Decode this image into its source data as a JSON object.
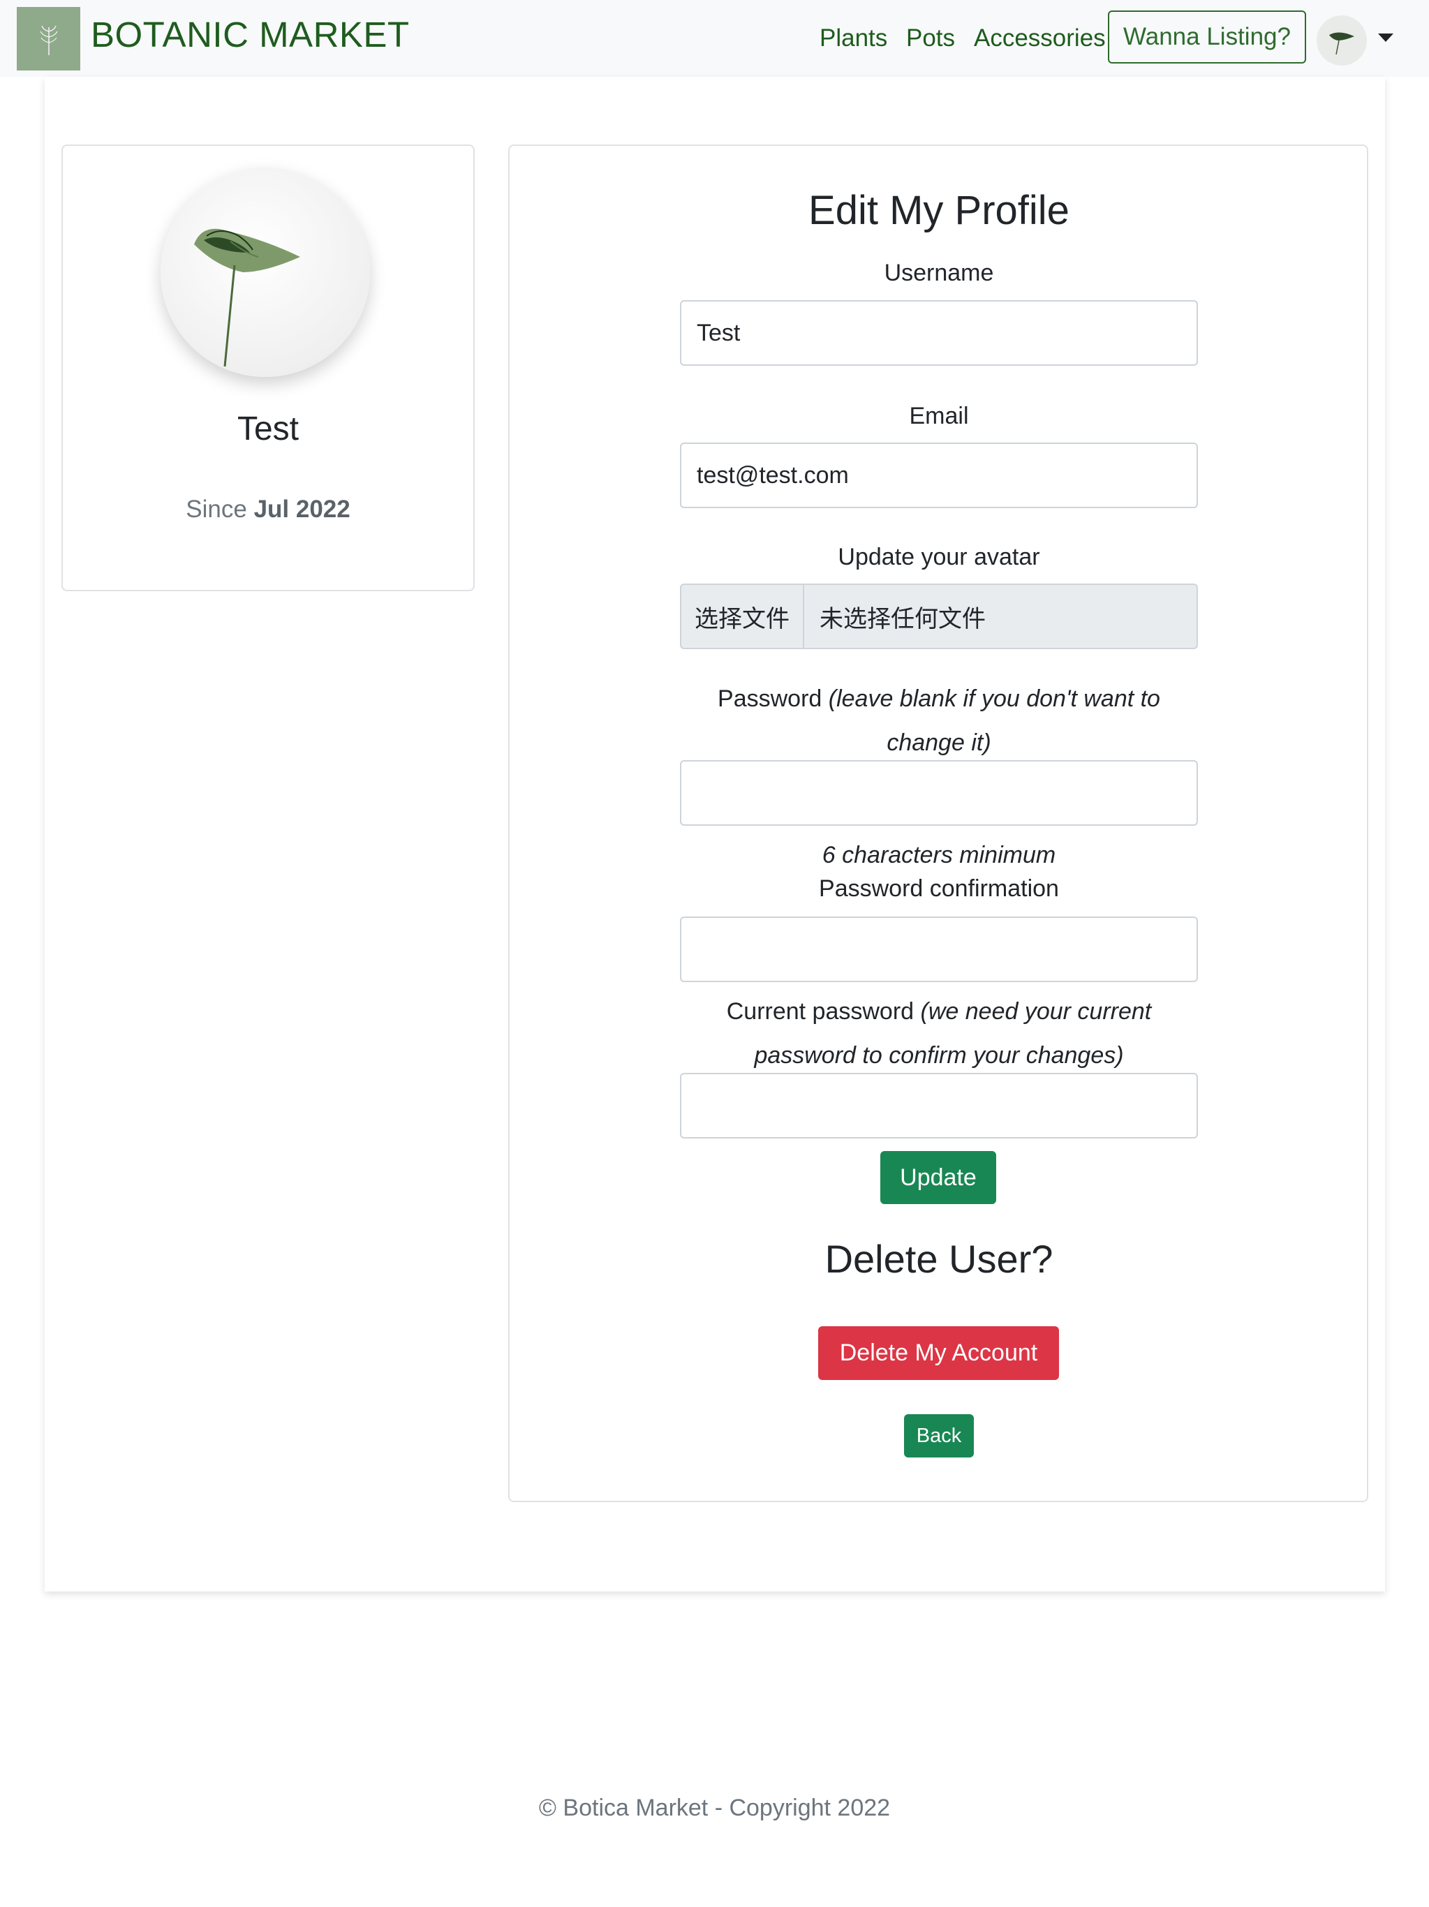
{
  "navbar": {
    "brand": "BOTANIC MARKET",
    "links": [
      "Plants",
      "Pots",
      "Accessories"
    ],
    "listing_button": "Wanna Listing?"
  },
  "profile": {
    "name": "Test",
    "since_label": "Since",
    "since_date": "Jul 2022"
  },
  "edit": {
    "title": "Edit My Profile",
    "username_label": "Username",
    "username_value": "Test",
    "email_label": "Email",
    "email_value": "test@test.com",
    "avatar_label": "Update your avatar",
    "file_button": "选择文件",
    "file_status": "未选择任何文件",
    "password_label": "Password",
    "password_hint_line1": "(leave blank if you don't want to",
    "password_hint_line2": "change it)",
    "password_min": "6 characters minimum",
    "confirm_label": "Password confirmation",
    "current_label": "Current password",
    "current_hint_line1": "(we need your current",
    "current_hint_line2": "password to confirm your changes)",
    "update_button": "Update",
    "delete_title": "Delete User?",
    "delete_button": "Delete My Account",
    "back_button": "Back"
  },
  "footer": {
    "text": "© Botica Market - Copyright 2022"
  },
  "colors": {
    "brand_green": "#1f5c1f",
    "success": "#198754",
    "danger": "#dc3545"
  }
}
